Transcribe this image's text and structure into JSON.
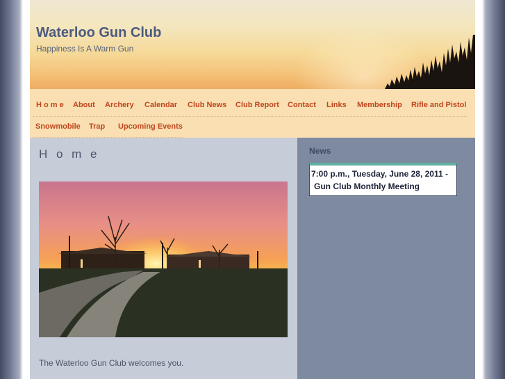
{
  "site": {
    "title": "Waterloo Gun Club",
    "tagline": "Happiness Is A Warm Gun"
  },
  "nav": {
    "items": [
      {
        "label": "H o m e"
      },
      {
        "label": "About"
      },
      {
        "label": "Archery"
      },
      {
        "label": "Calendar"
      },
      {
        "label": "Club News"
      },
      {
        "label": "Club Report"
      },
      {
        "label": "Contact"
      },
      {
        "label": "Links"
      },
      {
        "label": "Membership"
      },
      {
        "label": "Rifle and Pistol"
      },
      {
        "label": "Snowmobile"
      },
      {
        "label": "Trap"
      },
      {
        "label": "Upcoming Events"
      }
    ]
  },
  "main": {
    "title": "H o m e",
    "welcome": "The Waterloo Gun Club welcomes you."
  },
  "sidebar": {
    "news_heading": "News",
    "news_items": [
      {
        "line1": "7:00 p.m., Tuesday, June 28, 2011 -",
        "line2": "Gun Club Monthly Meeting"
      }
    ]
  },
  "colors": {
    "accent": "#c0461e",
    "title": "#4b5a80",
    "nav_bg": "#f9dfb2",
    "main_bg": "#c7ccd9",
    "sidebar_bg": "#7e8aa0",
    "news_border_top": "#5fb0a0"
  }
}
